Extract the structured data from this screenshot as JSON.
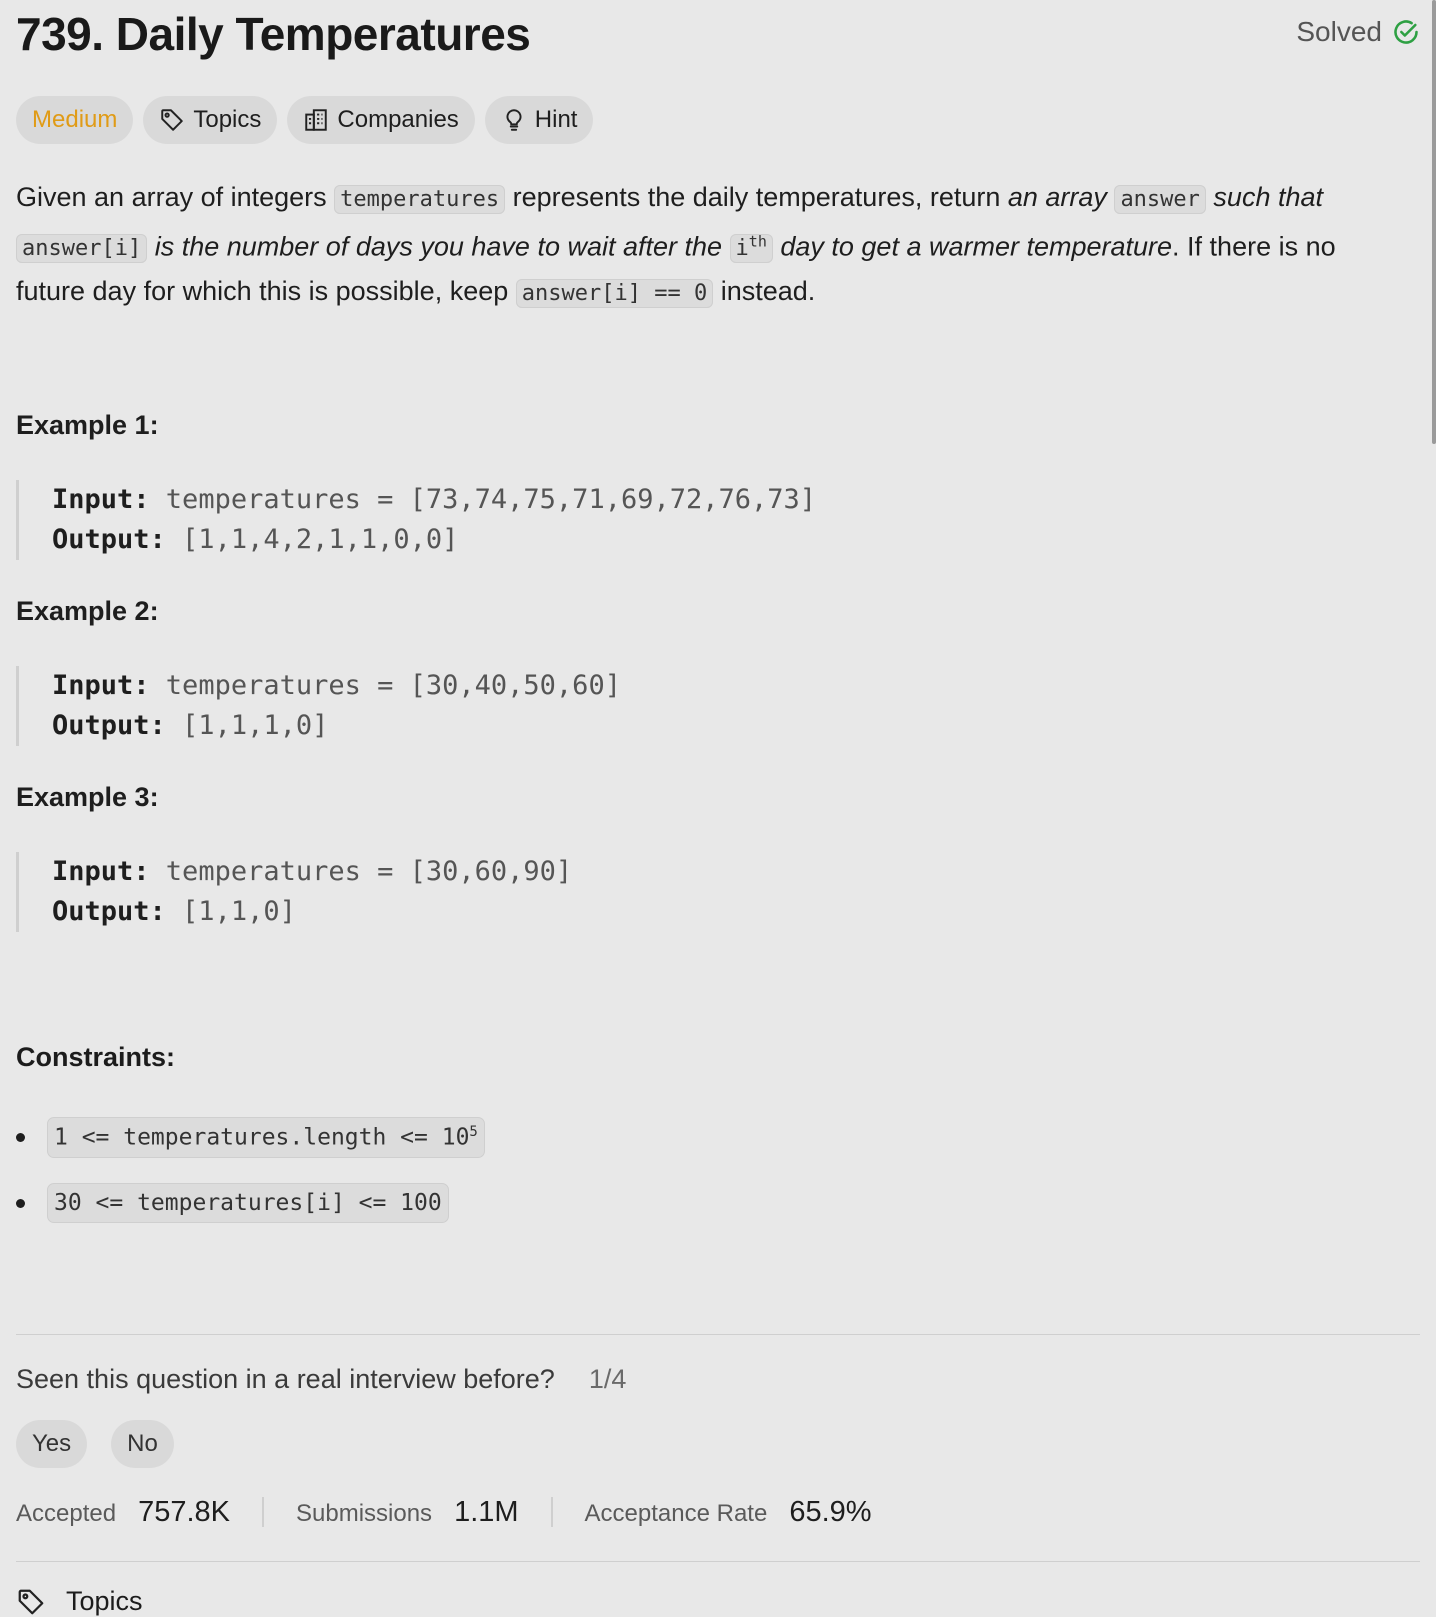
{
  "problem": {
    "title": "739. Daily Temperatures",
    "status": "Solved"
  },
  "tags": {
    "difficulty": "Medium",
    "topics": "Topics",
    "companies": "Companies",
    "hint": "Hint"
  },
  "description": {
    "p1": "Given an array of integers ",
    "c1": "temperatures",
    "p2": " represents the daily temperatures, return ",
    "i1": "an array ",
    "c2": "answer",
    "i2": " such that ",
    "c3": "answer[i]",
    "i3": " is the number of days you have to wait after the ",
    "c4": "i",
    "c4sup": "th",
    "i4": " day to get a warmer temperature",
    "p3": ". If there is no future day for which this is possible, keep ",
    "c5": "answer[i] == 0",
    "p4": " instead."
  },
  "examples": [
    {
      "title": "Example 1:",
      "input_label": "Input:",
      "input": " temperatures = [73,74,75,71,69,72,76,73]",
      "output_label": "Output:",
      "output": " [1,1,4,2,1,1,0,0]"
    },
    {
      "title": "Example 2:",
      "input_label": "Input:",
      "input": " temperatures = [30,40,50,60]",
      "output_label": "Output:",
      "output": " [1,1,1,0]"
    },
    {
      "title": "Example 3:",
      "input_label": "Input:",
      "input": " temperatures = [30,60,90]",
      "output_label": "Output:",
      "output": " [1,1,0]"
    }
  ],
  "constraints": {
    "title": "Constraints:",
    "c1": "1 <= temperatures.length <= 10",
    "c1sup": "5",
    "c2": "30 <= temperatures[i] <= 100"
  },
  "interview": {
    "question": "Seen this question in a real interview before?",
    "count": "1/4",
    "yes": "Yes",
    "no": "No"
  },
  "stats": {
    "accepted_label": "Accepted",
    "accepted": "757.8K",
    "submissions_label": "Submissions",
    "submissions": "1.1M",
    "rate_label": "Acceptance Rate",
    "rate": "65.9%"
  },
  "footer": {
    "topics": "Topics"
  },
  "colors": {
    "difficulty": "#e09b16",
    "solved_check": "#2ea043",
    "background": "#e8e8e8"
  },
  "icons": [
    "check-circle-icon",
    "tag-icon",
    "building-icon",
    "lightbulb-icon"
  ]
}
